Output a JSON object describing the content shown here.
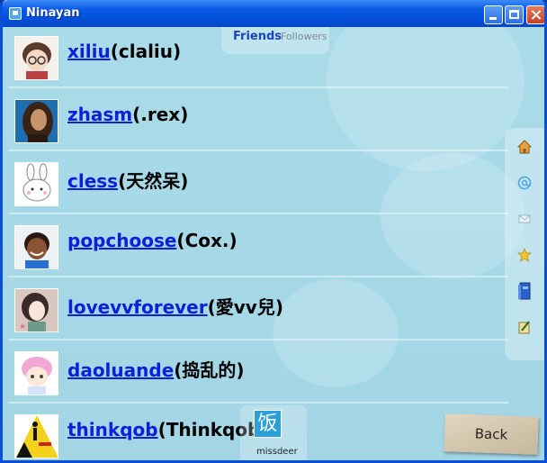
{
  "window": {
    "title": "Ninayan"
  },
  "tabs": {
    "friends": "Friends",
    "followers": "Followers"
  },
  "friends": [
    {
      "username": "xiliu",
      "display": "(claliu)",
      "avatar": "cartoon-boy-glasses"
    },
    {
      "username": "zhasm",
      "display": "(.rex)",
      "avatar": "photo-long-hair-man"
    },
    {
      "username": "cless",
      "display": "(天然呆)",
      "avatar": "white-bunny-drawing"
    },
    {
      "username": "popchoose",
      "display": "(Cox.)",
      "avatar": "cartoon-smiling-man"
    },
    {
      "username": "lovevvforever",
      "display": "(愛vv兒)",
      "avatar": "anime-girl"
    },
    {
      "username": "daoluande",
      "display": "(捣乱的)",
      "avatar": "pink-hair-chibi"
    },
    {
      "username": "thinkqob",
      "display": "(Thinkqob",
      "avatar": "yellow-warning-sign"
    }
  ],
  "sidebar_icons": [
    "home-icon",
    "mention-icon",
    "mail-icon",
    "star-icon",
    "book-icon",
    "edit-icon"
  ],
  "float_user": {
    "glyph": "饭",
    "label": "missdeer"
  },
  "back_button": {
    "label": "Back"
  },
  "colors": {
    "link": "#0b20d8",
    "titlebar": "#0250d8",
    "background": "#a9dbe8"
  }
}
